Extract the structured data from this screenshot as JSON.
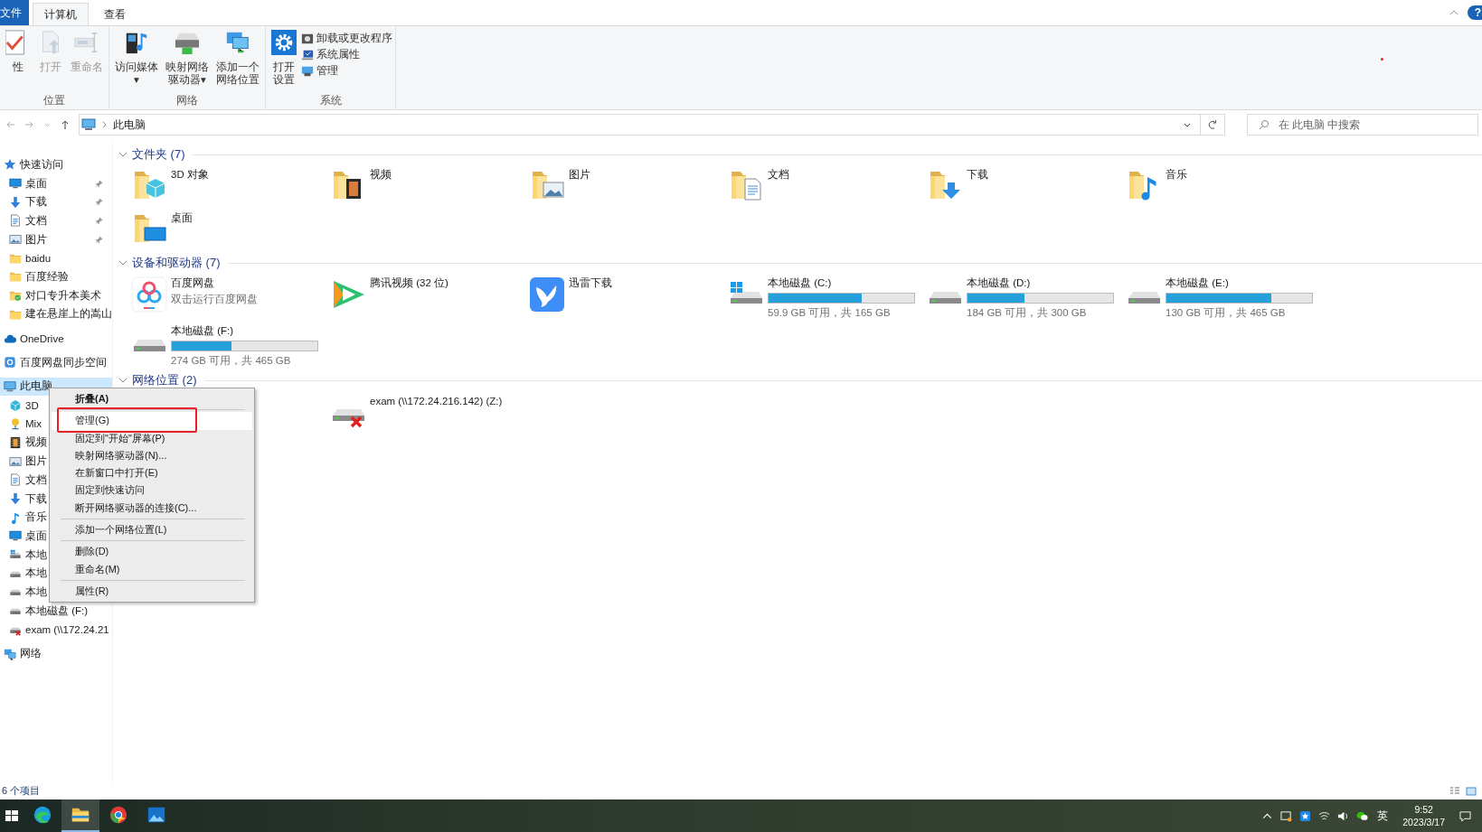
{
  "ribbon_tabs": [
    {
      "label": "文件",
      "kind": "file"
    },
    {
      "label": "计算机",
      "kind": "tab",
      "selected": true
    },
    {
      "label": "查看",
      "kind": "tab",
      "selected": false
    }
  ],
  "help": "?",
  "ribbon_groups": [
    {
      "label": "位置",
      "buttons": [
        {
          "lines": [
            "性"
          ],
          "kind": "check",
          "disabled": false
        },
        {
          "lines": [
            "打开"
          ],
          "kind": "open",
          "disabled": true
        },
        {
          "lines": [
            "重命名"
          ],
          "kind": "rename",
          "disabled": true
        }
      ]
    },
    {
      "label": "网络",
      "buttons": [
        {
          "lines": [
            "访问媒体"
          ],
          "kind": "media",
          "disabled": false,
          "caret": "▾"
        },
        {
          "lines": [
            "映射网络",
            "驱动器"
          ],
          "kind": "mapdrive",
          "disabled": false,
          "caret": "▾"
        },
        {
          "lines": [
            "添加一个",
            "网络位置"
          ],
          "kind": "addloc",
          "disabled": false
        }
      ]
    },
    {
      "label": "系统",
      "buttons": [
        {
          "lines": [
            "打开",
            "设置"
          ],
          "kind": "settings",
          "disabled": false
        }
      ],
      "small": [
        {
          "label": "卸载或更改程序",
          "kind": "uninstall"
        },
        {
          "label": "系统属性",
          "kind": "sysprops"
        },
        {
          "label": "管理",
          "kind": "manage"
        }
      ]
    }
  ],
  "address": {
    "path": "此电脑",
    "search_placeholder": "在 此电脑 中搜索"
  },
  "nav": [
    {
      "label": "快速访问",
      "kind": "star",
      "selected": false,
      "children": [
        {
          "label": "桌面",
          "kind": "desktop",
          "pinned": true,
          "selected": false
        },
        {
          "label": "下载",
          "kind": "download",
          "pinned": true,
          "selected": false
        },
        {
          "label": "文档",
          "kind": "document",
          "pinned": true,
          "selected": false
        },
        {
          "label": "图片",
          "kind": "picture",
          "pinned": true,
          "selected": false
        },
        {
          "label": "baidu",
          "kind": "folder",
          "pinned": false,
          "selected": false
        },
        {
          "label": "百度经验",
          "kind": "folder",
          "pinned": false,
          "selected": false
        },
        {
          "label": "对口专升本美术",
          "kind": "foldercheck",
          "pinned": false,
          "selected": false
        },
        {
          "label": "建在悬崖上的嵩山",
          "kind": "folder",
          "pinned": false,
          "selected": false
        }
      ]
    },
    {
      "label": "OneDrive",
      "kind": "cloud",
      "selected": false
    },
    {
      "label": "百度网盘同步空间",
      "kind": "netdisk",
      "selected": false
    },
    {
      "label": "此电脑",
      "kind": "computer",
      "selected": true,
      "children": [
        {
          "label": "3D",
          "kind": "cube",
          "pinned": false,
          "selected": false
        },
        {
          "label": "Mix",
          "kind": "mix",
          "pinned": false,
          "selected": false
        },
        {
          "label": "视频",
          "kind": "video",
          "pinned": false,
          "selected": false
        },
        {
          "label": "图片",
          "kind": "picture",
          "pinned": false,
          "selected": false
        },
        {
          "label": "文档",
          "kind": "document",
          "pinned": false,
          "selected": false
        },
        {
          "label": "下载",
          "kind": "download",
          "pinned": false,
          "selected": false
        },
        {
          "label": "音乐",
          "kind": "music",
          "pinned": false,
          "selected": false
        },
        {
          "label": "桌面",
          "kind": "desktop",
          "pinned": false,
          "selected": false
        },
        {
          "label": "本地",
          "kind": "drivewin",
          "pinned": false,
          "selected": false
        },
        {
          "label": "本地",
          "kind": "drive",
          "pinned": false,
          "selected": false
        },
        {
          "label": "本地",
          "kind": "drive",
          "pinned": false,
          "selected": false
        },
        {
          "label": "本地磁盘 (F:)",
          "kind": "drive",
          "pinned": false,
          "selected": false
        },
        {
          "label": "exam (\\\\172.24.21",
          "kind": "drivex",
          "pinned": false,
          "selected": false
        }
      ]
    },
    {
      "label": "网络",
      "kind": "network",
      "selected": false
    }
  ],
  "sections": [
    {
      "title": "文件夹 (7)",
      "kind": "folders",
      "items": [
        {
          "name": "3D 对象",
          "kind": "cube"
        },
        {
          "name": "视频",
          "kind": "video"
        },
        {
          "name": "图片",
          "kind": "picture"
        },
        {
          "name": "文档",
          "kind": "document"
        },
        {
          "name": "下载",
          "kind": "download"
        },
        {
          "name": "音乐",
          "kind": "music"
        },
        {
          "name": "桌面",
          "kind": "desktop"
        }
      ]
    },
    {
      "title": "设备和驱动器 (7)",
      "kind": "devices",
      "items": [
        {
          "name": "百度网盘",
          "kind": "netdiskapp",
          "subtitle": "双击运行百度网盘"
        },
        {
          "name": "腾讯视频 (32 位)",
          "kind": "playapp"
        },
        {
          "name": "迅雷下载",
          "kind": "birdapp"
        },
        {
          "name": "本地磁盘 (C:)",
          "kind": "drivewin",
          "level": 0.64,
          "info": "59.9 GB 可用，共 165 GB"
        },
        {
          "name": "本地磁盘 (D:)",
          "kind": "drive",
          "level": 0.39,
          "info": "184 GB 可用，共 300 GB"
        },
        {
          "name": "本地磁盘 (E:)",
          "kind": "drive",
          "level": 0.72,
          "info": "130 GB 可用，共 465 GB"
        },
        {
          "name": "本地磁盘 (F:)",
          "kind": "drive",
          "level": 0.41,
          "info": "274 GB 可用，共 465 GB"
        }
      ]
    },
    {
      "title": "网络位置 (2)",
      "kind": "network",
      "items": [
        {
          "name": "exam (\\\\172.24.216.142) (Z:)",
          "kind": "drivex"
        }
      ]
    }
  ],
  "context_menu": [
    {
      "label": "折叠(A)",
      "bold": true,
      "selected": false,
      "outlined": false,
      "divider_after": true
    },
    {
      "label": "管理(G)",
      "bold": false,
      "selected": true,
      "outlined": true,
      "divider_after": false
    },
    {
      "label": "固定到\"开始\"屏幕(P)",
      "bold": false,
      "selected": false,
      "outlined": false,
      "divider_after": false
    },
    {
      "label": "映射网络驱动器(N)...",
      "bold": false,
      "selected": false,
      "outlined": false,
      "divider_after": false
    },
    {
      "label": "在新窗口中打开(E)",
      "bold": false,
      "selected": false,
      "outlined": false,
      "divider_after": false
    },
    {
      "label": "固定到快速访问",
      "bold": false,
      "selected": false,
      "outlined": false,
      "divider_after": false
    },
    {
      "label": "断开网络驱动器的连接(C)...",
      "bold": false,
      "selected": false,
      "outlined": false,
      "divider_after": true
    },
    {
      "label": "添加一个网络位置(L)",
      "bold": false,
      "selected": false,
      "outlined": false,
      "divider_after": true
    },
    {
      "label": "删除(D)",
      "bold": false,
      "selected": false,
      "outlined": false,
      "divider_after": false
    },
    {
      "label": "重命名(M)",
      "bold": false,
      "selected": false,
      "outlined": false,
      "divider_after": true
    },
    {
      "label": "属性(R)",
      "bold": false,
      "selected": false,
      "outlined": false,
      "divider_after": false
    }
  ],
  "status_bar": {
    "count": "6 个项目"
  },
  "taskbar": {
    "apps": [
      {
        "kind": "edge",
        "selected": false
      },
      {
        "kind": "explorer",
        "selected": true
      },
      {
        "kind": "chrome",
        "selected": false
      },
      {
        "kind": "photos",
        "selected": false
      }
    ],
    "ime": "英",
    "time": "9:52",
    "date": "2023/3/17"
  }
}
